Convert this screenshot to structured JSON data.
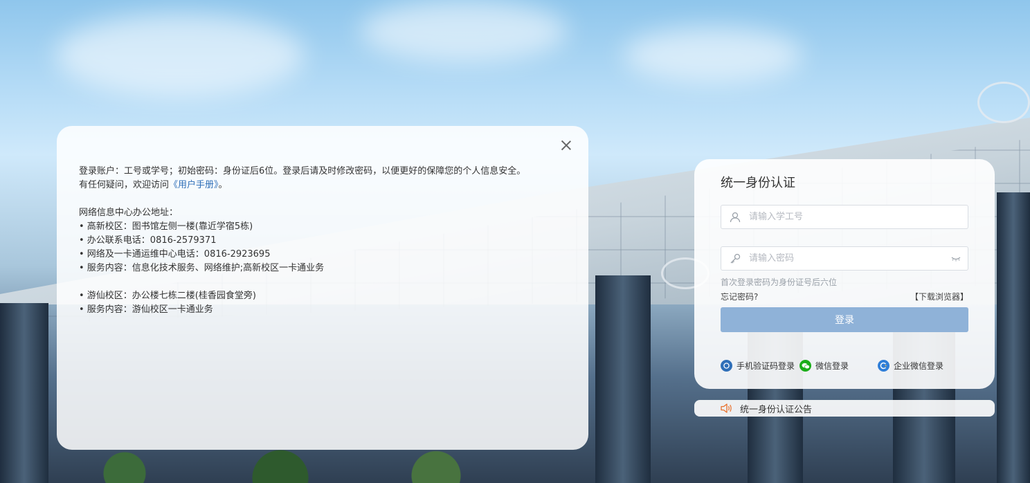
{
  "info": {
    "line1": "登录账户：工号或学号；初始密码：身份证后6位。登录后请及时修改密码，以便更好的保障您的个人信息安全。",
    "line2_prefix": "有任何疑问，欢迎访问",
    "manual_link": "《用户手册》",
    "line2_suffix": "。",
    "office_heading": "网络信息中心办公地址：",
    "gaoxin_address": "• 高新校区：图书馆左侧一楼(靠近学宿5栋)",
    "office_phone": "• 办公联系电话：0816-2579371",
    "card_center_phone": "• 网络及一卡通运维中心电话：0816-2923695",
    "gaoxin_services": "• 服务内容：信息化技术服务、网络维护;高新校区一卡通业务",
    "youxian_address": "• 游仙校区：办公楼七栋二楼(桂香园食堂旁)",
    "youxian_services": "• 服务内容：游仙校区一卡通业务"
  },
  "login": {
    "title": "统一身份认证",
    "username_placeholder": "请输入学工号",
    "password_placeholder": "请输入密码",
    "password_hint": "首次登录密码为身份证号后六位",
    "forgot_password": "忘记密码?",
    "download_browser": "【下载浏览器】",
    "submit_label": "登录",
    "sms_login": "手机验证码登录",
    "wechat_login": "微信登录",
    "enterprise_wechat_login": "企业微信登录"
  },
  "notice": {
    "label": "统一身份认证公告"
  },
  "colors": {
    "accent": "#2f6fb8",
    "button": "#8fb2d8",
    "wechat": "#1aad19",
    "notice_icon": "#e8702a"
  },
  "icons": {
    "close": "close-icon",
    "user": "user-icon",
    "key": "key-icon",
    "eye": "eye-closed-icon",
    "sms": "sms-icon",
    "wechat": "wechat-icon",
    "enterprise_wechat": "enterprise-wechat-icon",
    "speaker": "speaker-icon"
  }
}
